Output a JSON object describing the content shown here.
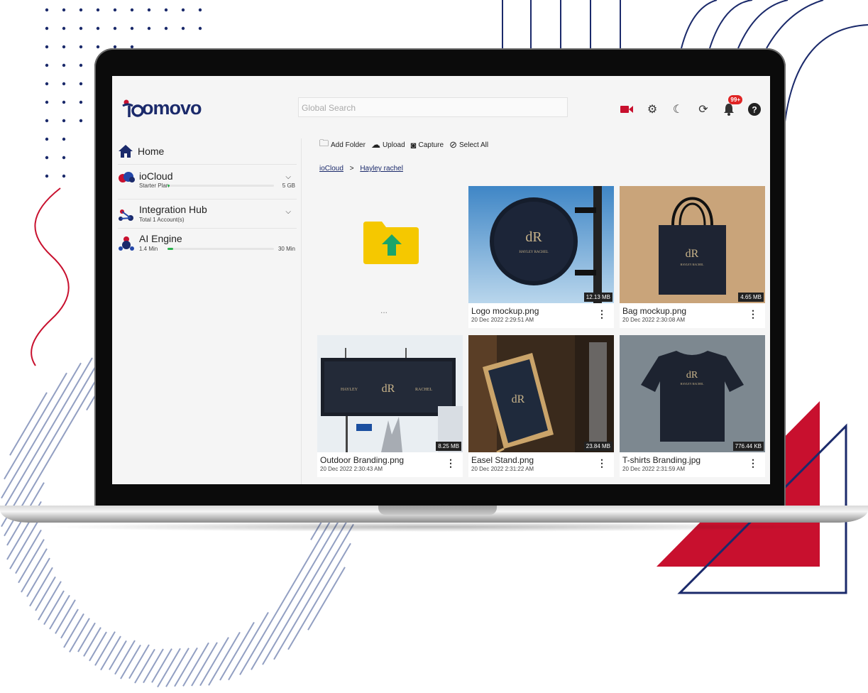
{
  "app": {
    "logo_text": "omovo",
    "search_placeholder": "Global Search",
    "notification_badge": "99+"
  },
  "toolbar": {
    "add_folder": "Add Folder",
    "upload": "Upload",
    "capture": "Capture",
    "select_all": "Select All"
  },
  "breadcrumb": {
    "root": "ioCloud",
    "separator": ">",
    "current": "Hayley rachel"
  },
  "sidebar": {
    "home": "Home",
    "iocloud": {
      "title": "ioCloud",
      "plan": "Starter Plan",
      "limit": "5 GB",
      "usage_fraction": 0.02
    },
    "integration": {
      "title": "Integration Hub",
      "accounts": "Total 1 Account(s)"
    },
    "ai": {
      "title": "AI Engine",
      "used": "1.4 Min",
      "limit": "30 Min",
      "usage_fraction": 0.05
    }
  },
  "folder_tile": {
    "dots": "..."
  },
  "files": [
    {
      "name": "Logo mockup.png",
      "date": "20 Dec 2022 2:29:51 AM",
      "size": "12.13 MB"
    },
    {
      "name": "Bag mockup.png",
      "date": "20 Dec 2022 2:30:08 AM",
      "size": "4.65 MB"
    },
    {
      "name": "Outdoor Branding.png",
      "date": "20 Dec 2022 2:30:43 AM",
      "size": "8.25 MB"
    },
    {
      "name": "Easel Stand.png",
      "date": "20 Dec 2022 2:31:22 AM",
      "size": "23.84 MB"
    },
    {
      "name": "T-shirts Branding.jpg",
      "date": "20 Dec 2022 2:31:59 AM",
      "size": "776.44 KB"
    }
  ],
  "colors": {
    "brand_navy": "#1b2a6b",
    "brand_red": "#c8102e",
    "progress": "#2bb24c"
  }
}
